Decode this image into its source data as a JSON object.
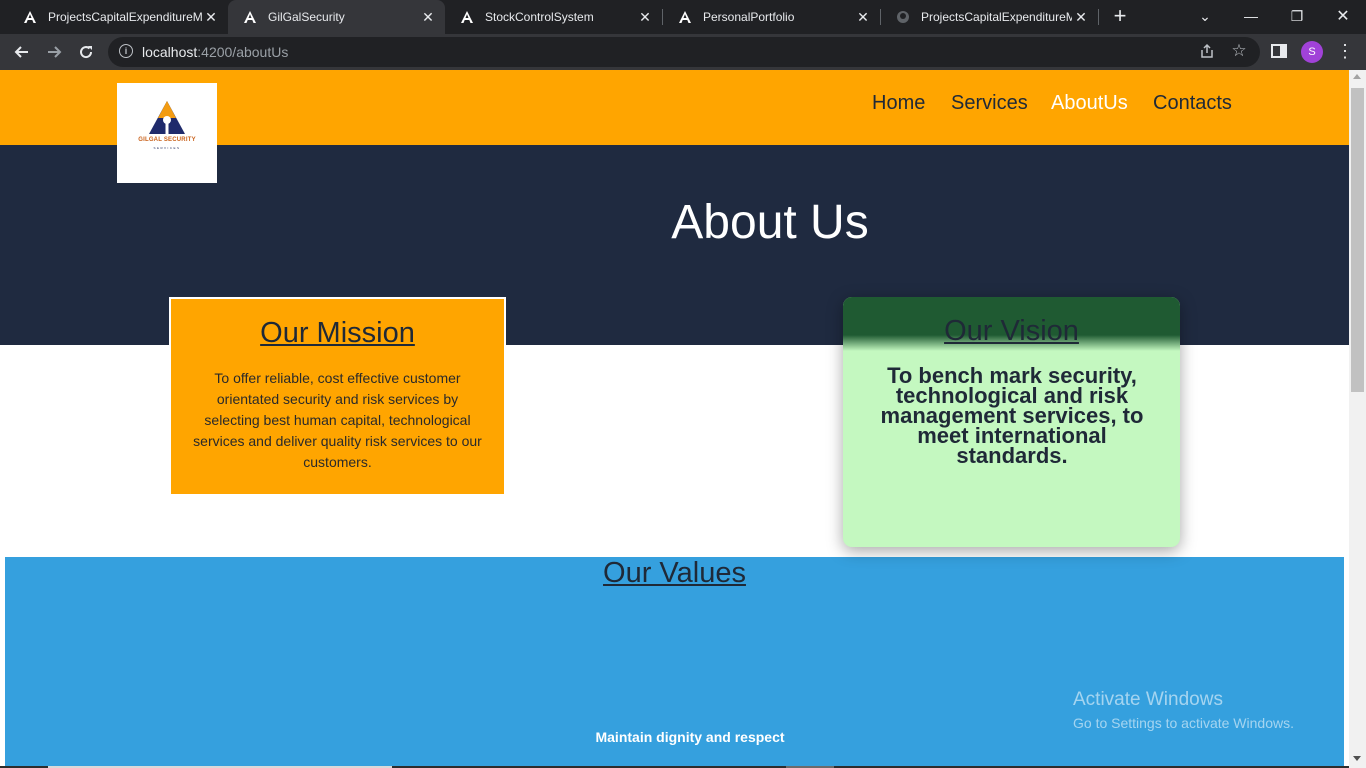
{
  "browser": {
    "tabs": [
      {
        "title": "ProjectsCapitalExpenditureM",
        "icon": "angular-icon"
      },
      {
        "title": "GilGalSecurity",
        "icon": "angular-icon"
      },
      {
        "title": "StockControlSystem",
        "icon": "angular-icon"
      },
      {
        "title": "PersonalPortfolio",
        "icon": "angular-icon"
      },
      {
        "title": "ProjectsCapitalExpenditureM",
        "icon": "github-icon"
      }
    ],
    "active_tab": "GilGalSecurity",
    "url_host": "localhost",
    "url_path": ":4200/aboutUs",
    "profile_initial": "S"
  },
  "site": {
    "logo_text": "GILGAL SECURITY",
    "logo_subtext": "SERVICES",
    "nav": [
      {
        "label": "Home"
      },
      {
        "label": "Services"
      },
      {
        "label": "AboutUs"
      },
      {
        "label": "Contacts"
      }
    ],
    "active_nav": "AboutUs",
    "hero_title": "About Us",
    "mission": {
      "title": "Our Mission",
      "text": "To offer reliable, cost effective customer orientated security and risk services by selecting best human capital, technological services and deliver quality risk services to our customers."
    },
    "vision": {
      "title": "Our Vision",
      "text": "To bench mark security, technological and risk management services, to meet international standards."
    },
    "values": {
      "title": "Our Values",
      "items": [
        "Maintain dignity and respect"
      ]
    }
  },
  "overlay": {
    "watermark_title": "Activate Windows",
    "watermark_subtitle": "Go to Settings to activate Windows."
  },
  "colors": {
    "header": "#ffa500",
    "hero": "#1f2a40",
    "mission_card": "#ffa500",
    "vision_header": "#1f5a32",
    "vision_card": "#c4f8c0",
    "values_section": "#35a0de"
  }
}
